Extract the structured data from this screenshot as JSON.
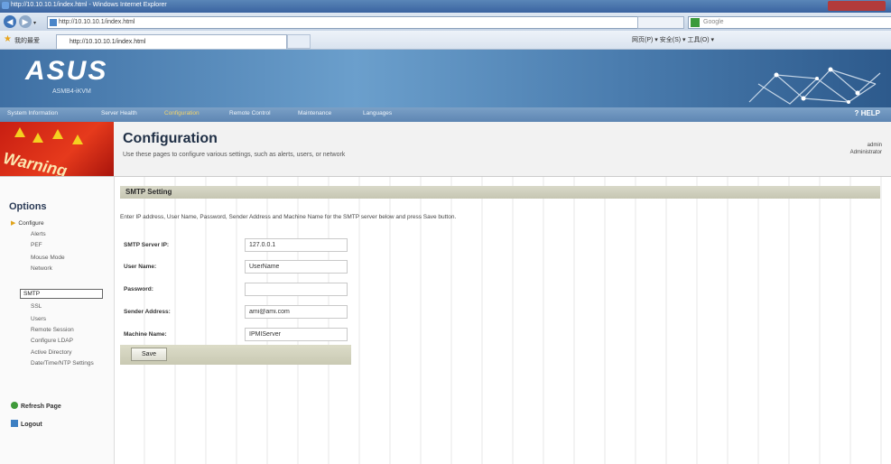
{
  "browser": {
    "title": "http://10.10.10.1/index.html - Windows Internet Explorer",
    "address": "http://10.10.10.1/index.html",
    "search_placeholder": "Google",
    "favorites_label": "我的最爱",
    "tab_title": "http://10.10.10.1/index.html",
    "toolbar": "网页(P) ▾  安全(S) ▾  工具(O) ▾"
  },
  "app": {
    "logo": "ASUS",
    "subtitle": "ASMB4-iKVM",
    "nav": [
      "System Information",
      "Server Health",
      "Configuration",
      "Remote Control",
      "Maintenance",
      "Languages"
    ],
    "help": "HELP",
    "warning_text": "Warning"
  },
  "page": {
    "title": "Configuration",
    "description": "Use these pages to configure various settings, such as alerts, users, or network",
    "user_line1": "admin",
    "user_line2": "Administrator"
  },
  "sidebar": {
    "header": "Options",
    "configure": "Configure",
    "items": [
      "Alerts",
      "PEF",
      "Mouse Mode",
      "Network",
      "SMTP",
      "SSL",
      "Users",
      "Remote Session",
      "Configure LDAP",
      "Active Directory",
      "Date/Time/NTP Settings"
    ],
    "refresh": "Refresh Page",
    "logout": "Logout"
  },
  "smtp": {
    "section_title": "SMTP Setting",
    "instructions": "Enter IP address, User Name, Password, Sender Address and Machine Name for the SMTP server below and press Save button.",
    "fields": [
      {
        "label": "SMTP Server IP:",
        "value": "127.0.0.1"
      },
      {
        "label": "User Name:",
        "value": "UserName"
      },
      {
        "label": "Password:",
        "value": ""
      },
      {
        "label": "Sender Address:",
        "value": "ami@ami.com"
      },
      {
        "label": "Machine Name:",
        "value": "IPMIServer"
      }
    ],
    "save": "Save"
  },
  "colors": {
    "accent_nav": "#f2d36a",
    "header_blue": "#4a7cae",
    "warning_red": "#c81e12"
  }
}
